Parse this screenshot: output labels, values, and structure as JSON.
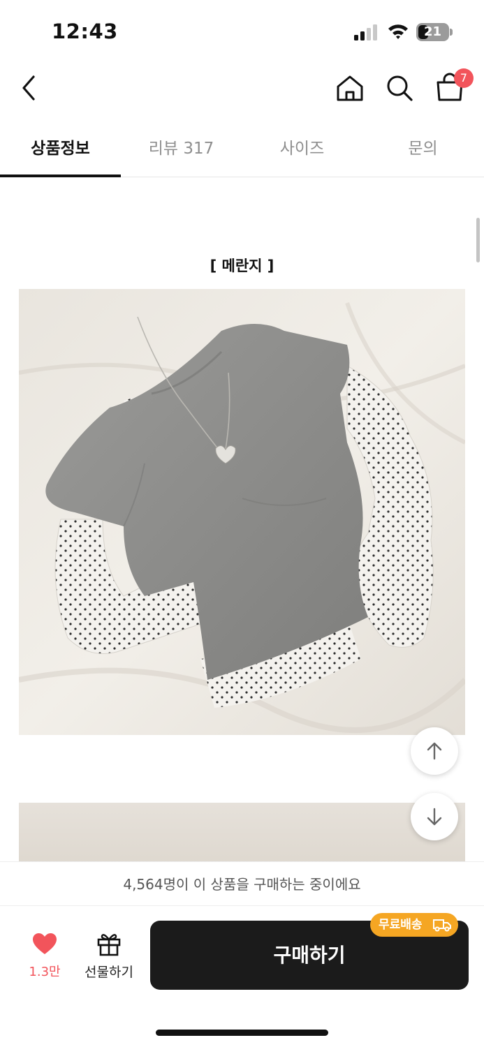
{
  "status_bar": {
    "time": "12:43",
    "battery": "21"
  },
  "nav": {
    "cart_count": "7"
  },
  "tabs": [
    {
      "label": "상품정보",
      "active": true
    },
    {
      "label": "리뷰 317",
      "active": false
    },
    {
      "label": "사이즈",
      "active": false
    },
    {
      "label": "문의",
      "active": false
    }
  ],
  "content": {
    "heading": "[ 메란지 ]"
  },
  "social_proof": "4,564명이 이 상품을 구매하는 중이에요",
  "bottom_bar": {
    "like_count": "1.3만",
    "gift_label": "선물하기",
    "buy_label": "구매하기",
    "free_shipping_badge": "무료배송"
  },
  "colors": {
    "accent": "#f2545b",
    "badge": "#f5a623",
    "buy_button": "#1b1b1b"
  }
}
